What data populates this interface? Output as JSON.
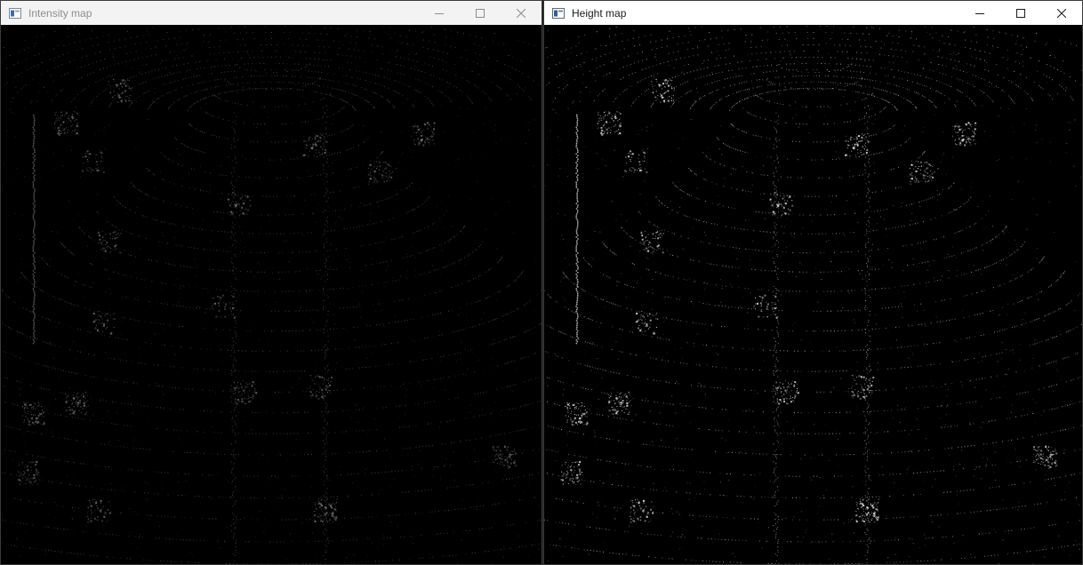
{
  "windows": [
    {
      "title": "Intensity map",
      "focused": false,
      "icon": "app-window-icon",
      "controls": [
        "minimize-icon",
        "maximize-icon",
        "close-icon"
      ],
      "point_color": "#8a8a8a"
    },
    {
      "title": "Height map",
      "focused": true,
      "icon": "app-window-icon",
      "controls": [
        "minimize-icon",
        "maximize-icon",
        "close-icon"
      ],
      "point_color": "#d8d8d8"
    }
  ],
  "colors": {
    "background": "#000000",
    "titlebar_inactive": "#f3f3f3",
    "titlebar_active": "#ffffff"
  }
}
